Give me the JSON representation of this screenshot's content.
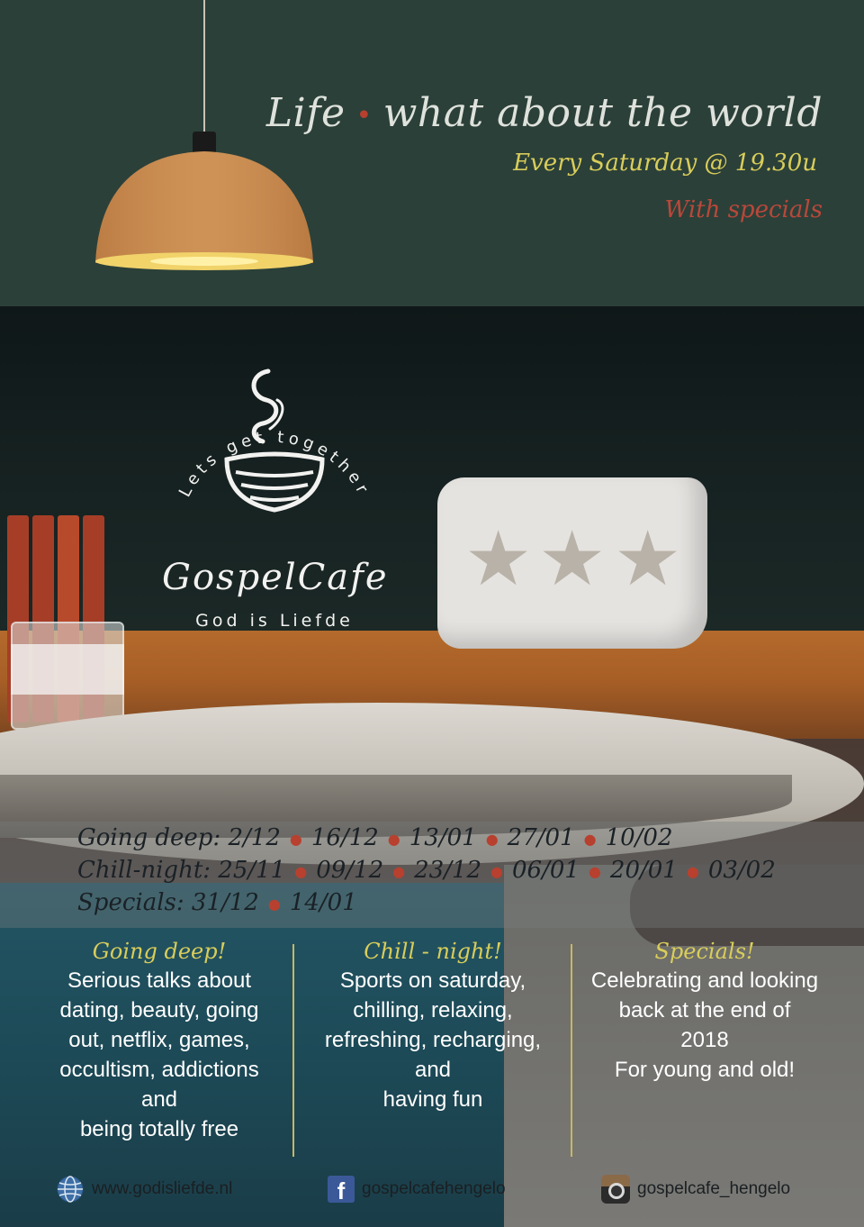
{
  "headline": {
    "part1": "Life",
    "part2": "what about the world",
    "separator": "•"
  },
  "schedule": "Every Saturday @ 19.30u",
  "specials_line": "With specials",
  "logo": {
    "arc_text": "Lets get together",
    "name": "GospelCafe",
    "subtitle": "God is Liefde"
  },
  "dates": [
    {
      "label": "Going deep:",
      "items": [
        "2/12",
        "16/12",
        "13/01",
        "27/01",
        "10/02"
      ]
    },
    {
      "label": "Chill-night:",
      "items": [
        "25/11",
        "09/12",
        "23/12",
        "06/01",
        "20/01",
        "03/02"
      ]
    },
    {
      "label": "Specials:",
      "items": [
        "31/12",
        "14/01"
      ]
    }
  ],
  "columns": [
    {
      "title": "Going deep!",
      "lines": [
        "Serious talks about",
        "dating, beauty, going",
        "out, netflix, games,",
        "occultism, addictions",
        "and",
        "being totally free"
      ]
    },
    {
      "title": "Chill - night!",
      "lines": [
        "Sports on saturday,",
        "chilling, relaxing,",
        "refreshing, recharging,",
        "and",
        "having fun"
      ]
    },
    {
      "title": "Specials!",
      "lines": [
        "Celebrating and looking",
        "back at the end of",
        "2018",
        "For young and old!"
      ]
    }
  ],
  "footer": {
    "website": {
      "icon": "globe-icon",
      "text": "www.godisliefde.nl"
    },
    "facebook": {
      "icon": "facebook-icon",
      "text": "gospelcafehengelo"
    },
    "instagram": {
      "icon": "instagram-icon",
      "text": "gospelcafe_hengelo"
    }
  },
  "colors": {
    "top_band": "#2b4039",
    "gold": "#d9cd5a",
    "red": "#b9483a",
    "cloth": "#235564"
  }
}
